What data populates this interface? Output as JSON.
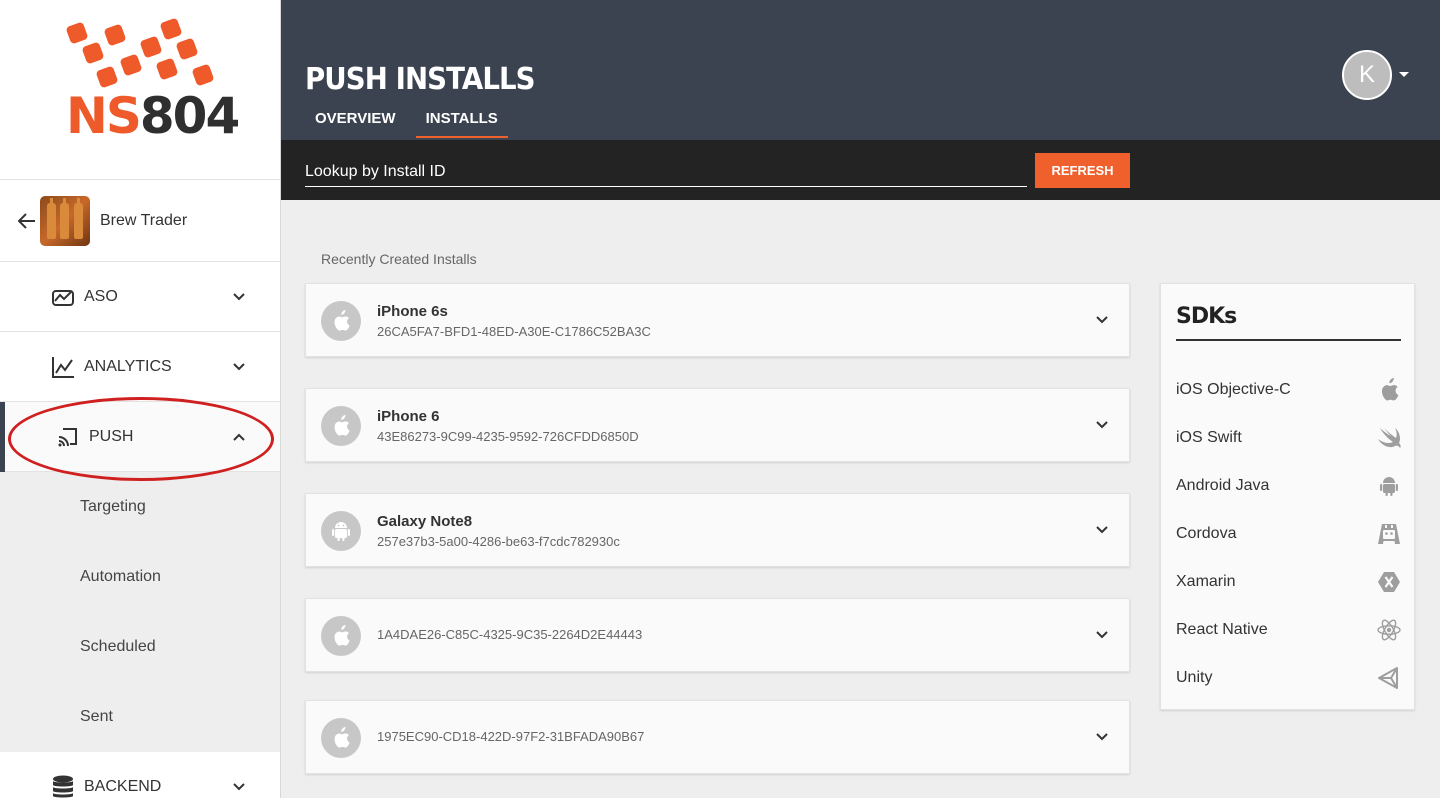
{
  "brand": {
    "logo_letters": "NS",
    "logo_number": "804",
    "accent_color": "#f0602d",
    "logo_red": "#ee5a2a"
  },
  "sidebar": {
    "app": {
      "name": "Brew Trader",
      "icon": "brew-trader-app-icon"
    },
    "nav": [
      {
        "label": "ASO",
        "icon": "aso-chart-icon",
        "state": "collapsed"
      },
      {
        "label": "ANALYTICS",
        "icon": "analytics-line-chart-icon",
        "state": "collapsed"
      },
      {
        "label": "PUSH",
        "icon": "cast-icon",
        "state": "expanded"
      },
      {
        "label": "BACKEND",
        "icon": "database-icon",
        "state": "collapsed"
      }
    ],
    "push_subnav": [
      "Targeting",
      "Automation",
      "Scheduled",
      "Sent"
    ]
  },
  "header": {
    "title": "PUSH INSTALLS",
    "tabs": [
      {
        "label": "OVERVIEW"
      },
      {
        "label": "INSTALLS",
        "active": true
      }
    ],
    "avatar_initial": "K",
    "header_color": "#3c4350"
  },
  "lookup": {
    "placeholder": "Lookup by Install ID",
    "refresh_label": "REFRESH"
  },
  "installs": {
    "section_label": "Recently Created Installs",
    "items": [
      {
        "name": "iPhone 6s",
        "id": "26CA5FA7-BFD1-48ED-A30E-C1786C52BA3C",
        "os": "apple-icon"
      },
      {
        "name": "iPhone 6",
        "id": "43E86273-9C99-4235-9592-726CFDD6850D",
        "os": "apple-icon"
      },
      {
        "name": "Galaxy Note8",
        "id": "257e37b3-5a00-4286-be63-f7cdc782930c",
        "os": "android-icon"
      },
      {
        "name": "",
        "id": "1A4DAE26-C85C-4325-9C35-2264D2E44443",
        "os": "apple-icon"
      },
      {
        "name": "",
        "id": "1975EC90-CD18-422D-97F2-31BFADA90B67",
        "os": "apple-icon"
      }
    ]
  },
  "sdks": {
    "title": "SDKs",
    "items": [
      {
        "label": "iOS Objective-C",
        "icon": "apple-icon"
      },
      {
        "label": "iOS Swift",
        "icon": "swift-icon"
      },
      {
        "label": "Android Java",
        "icon": "android-icon"
      },
      {
        "label": "Cordova",
        "icon": "cordova-icon"
      },
      {
        "label": "Xamarin",
        "icon": "xamarin-icon"
      },
      {
        "label": "React Native",
        "icon": "react-icon"
      },
      {
        "label": "Unity",
        "icon": "unity-icon"
      }
    ]
  }
}
